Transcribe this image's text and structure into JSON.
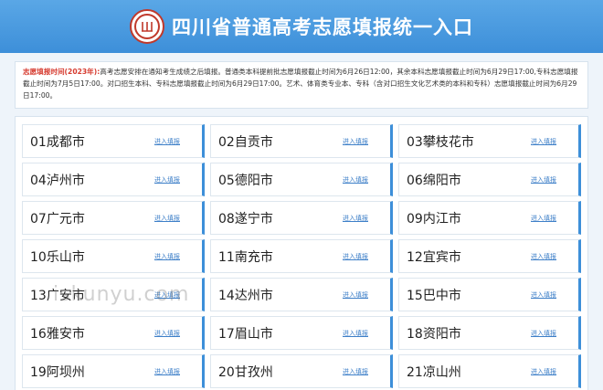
{
  "header": {
    "title": "四川省普通高考志愿填报统一入口"
  },
  "notice": {
    "label": "志愿填报时间(2023年):",
    "text": "高考志愿安排在通知考生成绩之后填报。普通类本科提前批志愿填报截止时间为6月26日12:00，其余本科志愿填报截止时间为6月29日17:00,专科志愿填报截止时间为7月5日17:00。对口招生本科、专科志愿填报截止时间为6月29日17:00。艺术、体育类专业本、专科（含对口招生文化艺术类的本科和专科）志愿填报截止时间为6月29日17:00。"
  },
  "cities": [
    {
      "name": "01成都市",
      "link": "进入填报"
    },
    {
      "name": "02自贡市",
      "link": "进入填报"
    },
    {
      "name": "03攀枝花市",
      "link": "进入填报"
    },
    {
      "name": "04泸州市",
      "link": "进入填报"
    },
    {
      "name": "05德阳市",
      "link": "进入填报"
    },
    {
      "name": "06绵阳市",
      "link": "进入填报"
    },
    {
      "name": "07广元市",
      "link": "进入填报"
    },
    {
      "name": "08遂宁市",
      "link": "进入填报"
    },
    {
      "name": "09内江市",
      "link": "进入填报"
    },
    {
      "name": "10乐山市",
      "link": "进入填报"
    },
    {
      "name": "11南充市",
      "link": "进入填报"
    },
    {
      "name": "12宜宾市",
      "link": "进入填报"
    },
    {
      "name": "13广安市",
      "link": "进入填报"
    },
    {
      "name": "14达州市",
      "link": "进入填报"
    },
    {
      "name": "15巴中市",
      "link": "进入填报"
    },
    {
      "name": "16雅安市",
      "link": "进入填报"
    },
    {
      "name": "17眉山市",
      "link": "进入填报"
    },
    {
      "name": "18资阳市",
      "link": "进入填报"
    },
    {
      "name": "19阿坝州",
      "link": "进入填报"
    },
    {
      "name": "20甘孜州",
      "link": "进入填报"
    },
    {
      "name": "21凉山州",
      "link": "进入填报"
    }
  ],
  "watermark": "iskunyu.com",
  "colors": {
    "header_blue": "#3d8fd9",
    "notice_red": "#d63b2f",
    "link_blue": "#3d7fc8",
    "logo_red": "#c0392b"
  }
}
